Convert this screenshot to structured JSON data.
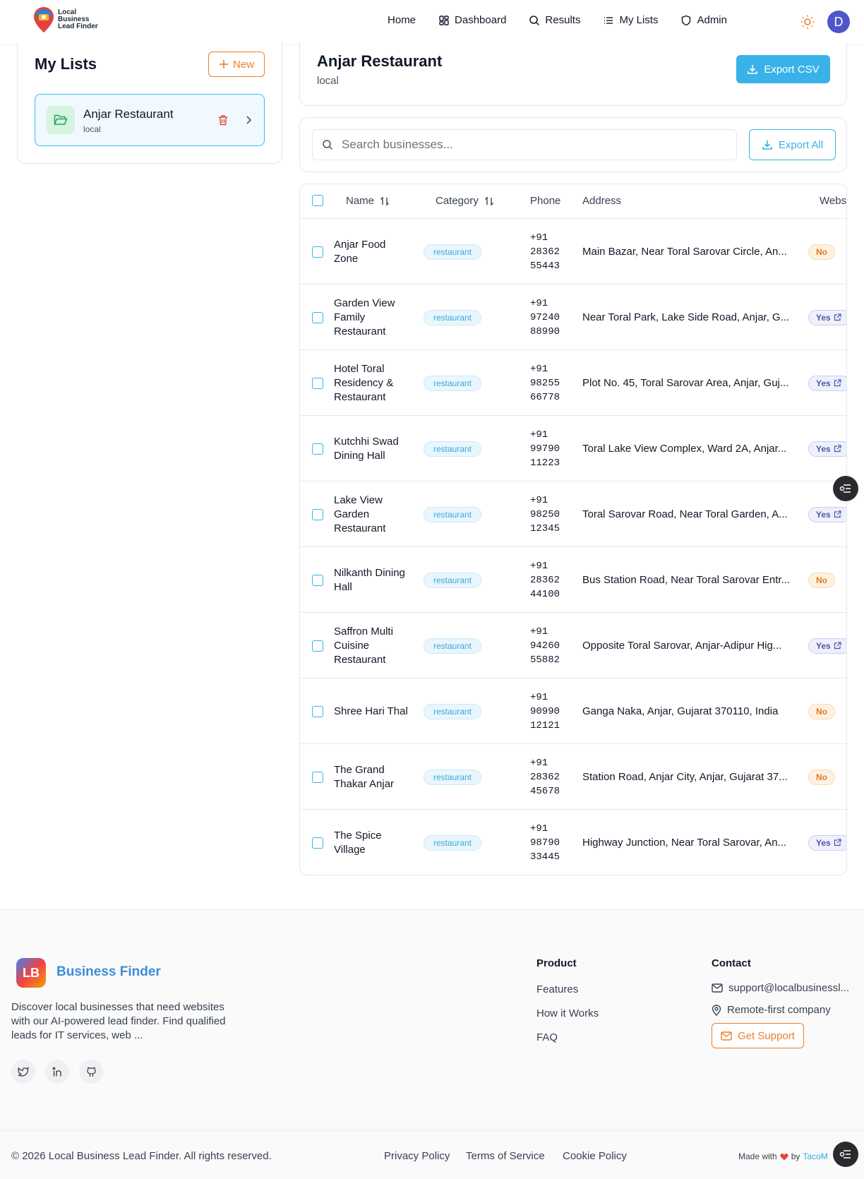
{
  "header": {
    "logo_lines": [
      "Local",
      "Business",
      "Lead Finder"
    ],
    "nav": [
      {
        "label": "Home",
        "icon": "none"
      },
      {
        "label": "Dashboard",
        "icon": "grid-icon"
      },
      {
        "label": "Results",
        "icon": "search-icon"
      },
      {
        "label": "My Lists",
        "icon": "list-icon"
      },
      {
        "label": "Admin",
        "icon": "shield-icon"
      }
    ],
    "theme_icon": "sun-icon",
    "avatar_initial": "D"
  },
  "sidebar": {
    "title": "My Lists",
    "new_label": "New",
    "lists": [
      {
        "name": "Anjar Restaurant",
        "sub": "local"
      }
    ]
  },
  "list_header": {
    "title": "Anjar Restaurant",
    "subtitle": "local",
    "export_csv_label": "Export CSV"
  },
  "search": {
    "placeholder": "Search businesses...",
    "export_all_label": "Export All"
  },
  "table": {
    "columns": [
      "Name",
      "Category",
      "Phone",
      "Address",
      "Webs"
    ],
    "rows": [
      {
        "name": "Anjar Food Zone",
        "category": "restaurant",
        "phone": "+91 28362 55443",
        "address": "Main Bazar, Near Toral Sarovar Circle, An...",
        "website": "No"
      },
      {
        "name": "Garden View Family Restaurant",
        "category": "restaurant",
        "phone": "+91 97240 88990",
        "address": "Near Toral Park, Lake Side Road, Anjar, G...",
        "website": "Yes"
      },
      {
        "name": "Hotel Toral Residency & Restaurant",
        "category": "restaurant",
        "phone": "+91 98255 66778",
        "address": "Plot No. 45, Toral Sarovar Area, Anjar, Guj...",
        "website": "Yes"
      },
      {
        "name": "Kutchhi Swad Dining Hall",
        "category": "restaurant",
        "phone": "+91 99790 11223",
        "address": "Toral Lake View Complex, Ward 2A, Anjar...",
        "website": "Yes"
      },
      {
        "name": "Lake View Garden Restaurant",
        "category": "restaurant",
        "phone": "+91 98250 12345",
        "address": "Toral Sarovar Road, Near Toral Garden, A...",
        "website": "Yes"
      },
      {
        "name": "Nilkanth Dining Hall",
        "category": "restaurant",
        "phone": "+91 28362 44100",
        "address": "Bus Station Road, Near Toral Sarovar Entr...",
        "website": "No"
      },
      {
        "name": "Saffron Multi Cuisine Restaurant",
        "category": "restaurant",
        "phone": "+91 94260 55882",
        "address": "Opposite Toral Sarovar, Anjar-Adipur Hig...",
        "website": "Yes"
      },
      {
        "name": "Shree Hari Thal",
        "category": "restaurant",
        "phone": "+91 90990 12121",
        "address": "Ganga Naka, Anjar, Gujarat 370110, India",
        "website": "No"
      },
      {
        "name": "The Grand Thakar Anjar",
        "category": "restaurant",
        "phone": "+91 28362 45678",
        "address": "Station Road, Anjar City, Anjar, Gujarat 37...",
        "website": "No"
      },
      {
        "name": "The Spice Village",
        "category": "restaurant",
        "phone": "+91 98790 33445",
        "address": "Highway Junction, Near Toral Sarovar, An...",
        "website": "Yes"
      }
    ]
  },
  "footer": {
    "logo_initials": "LB",
    "brand": "Business Finder",
    "description": "Discover local businesses that need websites with our AI-powered lead finder. Find qualified leads for IT services, web ...",
    "socials": [
      "twitter-icon",
      "linkedin-icon",
      "github-icon"
    ],
    "product_title": "Product",
    "product_links": [
      "Features",
      "How it Works",
      "FAQ"
    ],
    "contact_title": "Contact",
    "contact_email": "support@localbusinessl...",
    "contact_location": "Remote-first company",
    "get_support_label": "Get Support",
    "copyright": "© 2026 Local Business Lead Finder. All rights reserved.",
    "legal_links": [
      "Privacy Policy",
      "Terms of Service",
      "Cookie Policy"
    ],
    "made_with": "Made with",
    "made_by": "by",
    "made_brand": "TacoM"
  },
  "colors": {
    "accent_blue": "#38b2e8",
    "accent_orange": "#ea7f2c",
    "avatar": "#4f56c9"
  }
}
